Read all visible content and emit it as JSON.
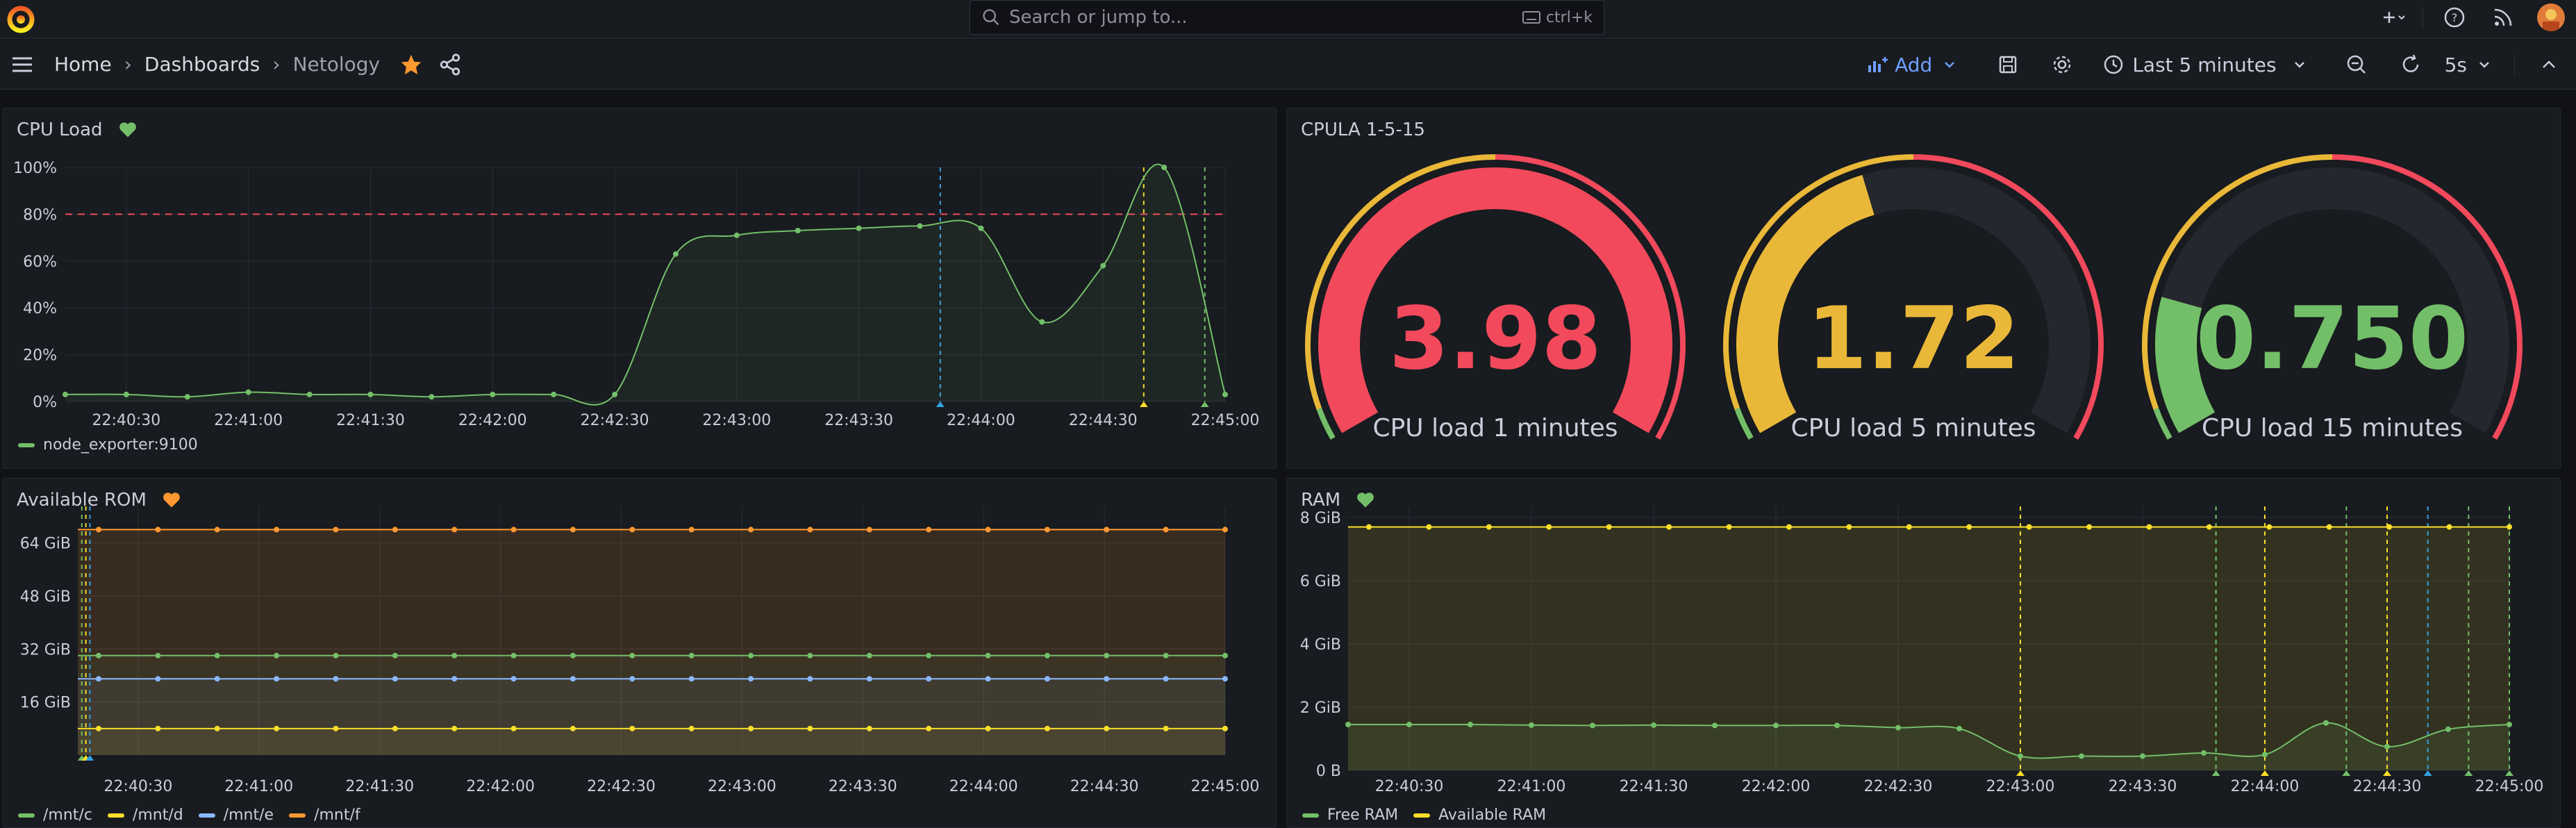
{
  "topbar": {
    "search_placeholder": "Search or jump to...",
    "search_shortcut": "ctrl+k"
  },
  "breadcrumb": {
    "home": "Home",
    "dashboards": "Dashboards",
    "current": "Netology"
  },
  "toolbar": {
    "add_label": "Add",
    "time_range": "Last 5 minutes",
    "refresh_interval": "5s"
  },
  "colors": {
    "accent": "#6e9fff",
    "green": "#73bf69",
    "yellow": "#fade2a",
    "orange": "#ff9830",
    "blue": "#8ab8ff",
    "red": "#f2495c",
    "gauge_yellow": "#eab839"
  },
  "panels": {
    "cpu_load": {
      "title": "CPU Load",
      "heart_icon": "heart-icon",
      "legend": [
        "node_exporter:9100"
      ]
    },
    "cpula": {
      "title": "CPULA 1-5-15"
    },
    "available_rom": {
      "title": "Available ROM",
      "legend": [
        "/mnt/c",
        "/mnt/d",
        "/mnt/e",
        "/mnt/f"
      ]
    },
    "ram": {
      "title": "RAM",
      "legend": [
        "Free RAM",
        "Available RAM"
      ]
    }
  },
  "gauges": [
    {
      "value": "3.98",
      "label": "CPU load 1 minutes",
      "fraction": 1.0,
      "color": "#f2495c"
    },
    {
      "value": "1.72",
      "label": "CPU load 5 minutes",
      "fraction": 0.43,
      "color": "#eab839"
    },
    {
      "value": "0.750",
      "label": "CPU load 15 minutes",
      "fraction": 0.19,
      "color": "#73bf69"
    }
  ],
  "chart_data": [
    {
      "type": "line",
      "title": "CPU Load",
      "x_ticks": [
        "22:40:30",
        "22:41:00",
        "22:41:30",
        "22:42:00",
        "22:42:30",
        "22:43:00",
        "22:43:30",
        "22:44:00",
        "22:44:30",
        "22:45:00"
      ],
      "y_ticks": [
        "0%",
        "20%",
        "40%",
        "60%",
        "80%",
        "100%"
      ],
      "ylim": [
        0,
        100
      ],
      "threshold": 80,
      "series": [
        {
          "name": "node_exporter:9100",
          "x": [
            "22:40:15",
            "22:40:30",
            "22:40:45",
            "22:41:00",
            "22:41:15",
            "22:41:30",
            "22:41:45",
            "22:42:00",
            "22:42:15",
            "22:42:30",
            "22:42:45",
            "22:43:00",
            "22:43:15",
            "22:43:30",
            "22:43:45",
            "22:44:00",
            "22:44:15",
            "22:44:30",
            "22:44:45",
            "22:45:00"
          ],
          "values": [
            3,
            3,
            2,
            4,
            3,
            3,
            2,
            3,
            3,
            3,
            63,
            71,
            73,
            74,
            75,
            74,
            34,
            58,
            100,
            3
          ]
        }
      ]
    },
    {
      "type": "area",
      "title": "Available ROM",
      "x_ticks": [
        "22:40:30",
        "22:41:00",
        "22:41:30",
        "22:42:00",
        "22:42:30",
        "22:43:00",
        "22:43:30",
        "22:44:00",
        "22:44:30",
        "22:45:00"
      ],
      "y_ticks": [
        "16 GiB",
        "32 GiB",
        "48 GiB",
        "64 GiB"
      ],
      "series": [
        {
          "name": "/mnt/c",
          "value_gib": 30
        },
        {
          "name": "/mnt/d",
          "value_gib": 8
        },
        {
          "name": "/mnt/e",
          "value_gib": 23
        },
        {
          "name": "/mnt/f",
          "value_gib": 68
        }
      ]
    },
    {
      "type": "area",
      "title": "RAM",
      "x_ticks": [
        "22:40:30",
        "22:41:00",
        "22:41:30",
        "22:42:00",
        "22:42:30",
        "22:43:00",
        "22:43:30",
        "22:44:00",
        "22:44:30",
        "22:45:00"
      ],
      "y_ticks": [
        "0 B",
        "2 GiB",
        "4 GiB",
        "6 GiB",
        "8 GiB"
      ],
      "ylim": [
        0,
        8
      ],
      "series": [
        {
          "name": "Free RAM",
          "x": [
            "22:40:15",
            "22:40:30",
            "22:40:45",
            "22:41:00",
            "22:41:15",
            "22:41:30",
            "22:41:45",
            "22:42:00",
            "22:42:15",
            "22:42:30",
            "22:42:45",
            "22:43:00",
            "22:43:15",
            "22:43:30",
            "22:43:45",
            "22:44:00",
            "22:44:15",
            "22:44:30",
            "22:44:45",
            "22:45:00"
          ],
          "values": [
            1.45,
            1.45,
            1.45,
            1.43,
            1.42,
            1.43,
            1.42,
            1.42,
            1.42,
            1.35,
            1.32,
            0.45,
            0.45,
            0.45,
            0.55,
            0.5,
            1.5,
            0.75,
            1.3,
            1.45
          ]
        },
        {
          "name": "Available RAM",
          "value_gib": 7.7
        }
      ]
    }
  ]
}
